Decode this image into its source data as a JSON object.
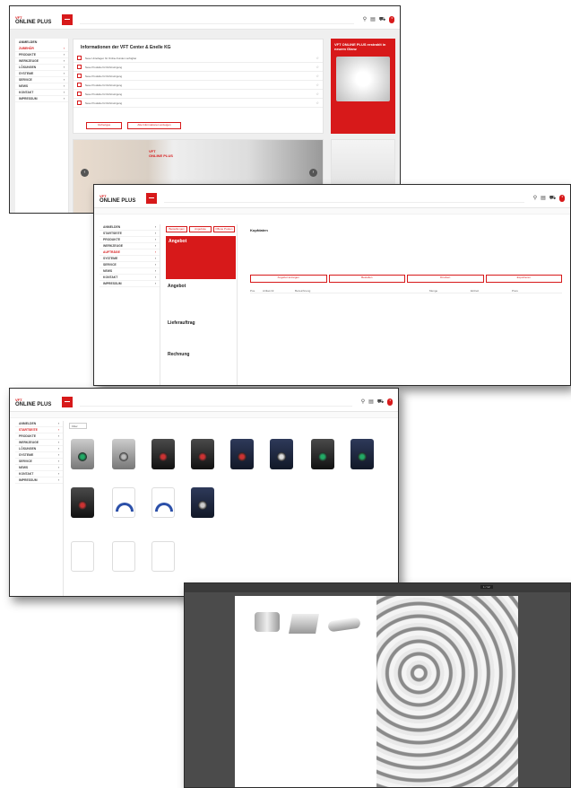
{
  "app": {
    "logo_top": "VFT",
    "logo_bottom": "ONLINE PLUS",
    "cart_count": "3"
  },
  "window1": {
    "sidebar_head": "ANMELDEN",
    "sidebar": [
      "ZUBEHÖR",
      "PRODUKTE",
      "WERKZEUGE",
      "LÖSUNGEN",
      "SYSTEME",
      "SERVICE",
      "NEWS",
      "KONTAKT",
      "IMPRESSUM"
    ],
    "info_title": "Informationen der VFT Center & Enelle KG",
    "info_rows": [
      "Neue Unterlagen für Online-Kunden verfügbar",
      "Neue Produkte für Rohrreinigung",
      "Neue Produkte für Rohrreinigung",
      "Neue Produkte für Rohrreinigung",
      "Neue Produkte für Rohrreinigung",
      "Neue Produkte für Rohrreinigung"
    ],
    "btn_left": "Vorheriges",
    "btn_right": "Alle Informationen anzeigen",
    "promo_title": "VFT ONLINE PLUS erstrahlt in neuem Glanz",
    "banner_line1": "VFT",
    "banner_line2": "ONLINE PLUS"
  },
  "window2": {
    "tabs": [
      "Bestellungen",
      "Angebote",
      "Offene Posten"
    ],
    "sidebar": [
      "ANMELDEN",
      "STARTSEITE",
      "PRODUKTE",
      "WERKZEUGE",
      "AUFTRÄGE",
      "SYSTEME",
      "SERVICE",
      "NEWS",
      "KONTAKT",
      "IMPRESSUM"
    ],
    "offer_title": "Angebot",
    "section_title": "Kopfdaten",
    "offer_heading2": "Angebot",
    "delivery_title": "Lieferauftrag",
    "invoice_title": "Rechnung",
    "actions": [
      "Angebot anzeigen",
      "Bestellen",
      "Drucken",
      "Exportieren"
    ],
    "table_headers": [
      "Pos.",
      "Artikel-Nr.",
      "Bezeichnung",
      "Menge",
      "Einheit",
      "Preis"
    ]
  },
  "window3": {
    "sidebar": [
      "ANMELDEN",
      "STARTSEITE",
      "PRODUKTE",
      "WERKZEUGE",
      "LÖSUNGEN",
      "SYSTEME",
      "SERVICE",
      "NEWS",
      "KONTAKT",
      "IMPRESSUM"
    ],
    "filter": "Filter"
  },
  "window4": {
    "page_label": "1 / 12"
  }
}
